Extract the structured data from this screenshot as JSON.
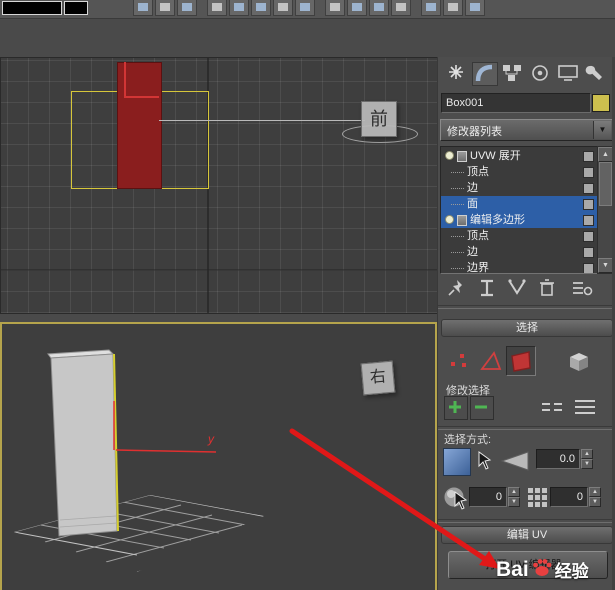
{
  "colors": {
    "highlight_blue": "#2d5fa7",
    "arrow_red": "#e01818",
    "swatch_yellow": "#cdbf4e",
    "box_red": "#8a1e1e",
    "active_viewport_border": "#b5a44c"
  },
  "toolbar": {
    "icons": [
      "named-selection-set",
      "mirror-icon",
      "align-icon",
      "layer-manager-icon",
      "graph-editors-icon",
      "material-editor-icon",
      "render-setup-icon",
      "render-frame-icon",
      "snap-toggle-icon"
    ]
  },
  "viewports": {
    "front": {
      "gizmo_label": "前"
    },
    "right": {
      "gizmo_label": "右",
      "axis_y_label": "y"
    }
  },
  "command_panel": {
    "tabs": [
      {
        "name": "create",
        "icon": "create-icon"
      },
      {
        "name": "modify",
        "icon": "modify-icon",
        "active": true
      },
      {
        "name": "hierarchy",
        "icon": "hierarchy-icon"
      },
      {
        "name": "motion",
        "icon": "motion-icon"
      },
      {
        "name": "display",
        "icon": "display-icon"
      },
      {
        "name": "utilities",
        "icon": "utilities-icon"
      }
    ],
    "object_name": "Box001",
    "modifier_dropdown": {
      "label": "修改器列表"
    },
    "stack": {
      "items": [
        {
          "label": "UVW 展开",
          "kind": "modifier",
          "selected": false
        },
        {
          "label": "顶点",
          "kind": "subobject",
          "selected": false
        },
        {
          "label": "边",
          "kind": "subobject",
          "selected": false
        },
        {
          "label": "面",
          "kind": "subobject",
          "selected": true
        },
        {
          "label": "编辑多边形",
          "kind": "modifier",
          "selected": true
        },
        {
          "label": "顶点",
          "kind": "subobject",
          "selected": false
        },
        {
          "label": "边",
          "kind": "subobject",
          "selected": false
        },
        {
          "label": "边界",
          "kind": "subobject",
          "selected": false
        }
      ]
    },
    "stack_toolbar_icons": [
      "pin-stack-icon",
      "show-end-result-icon",
      "make-unique-icon",
      "remove-modifier-icon",
      "configure-modifier-sets-icon"
    ],
    "selection_rollout": {
      "title": "选择",
      "subobject_icons": [
        "vertex-dots-icon",
        "edge-triangle-icon",
        "face-icon",
        "element-cube-icon"
      ],
      "modify_selection_label": "修改选择",
      "grow_shrink_icons": [
        "grow-selection-icon",
        "shrink-selection-icon",
        "loop-icon",
        "ring-icon"
      ],
      "select_by_label": "选择方式:",
      "spinner_angle": "0.0",
      "spinner_a": "0",
      "spinner_b": "0"
    },
    "edit_uv_rollout": {
      "title": "编辑 UV",
      "open_button": "打开 UV 编辑器..."
    }
  },
  "glyphs": {
    "dropdown_arrow": "▼",
    "spinner_up": "▲",
    "spinner_down": "▼",
    "scroll_up": "▲",
    "scroll_down": "▼"
  },
  "watermark": {
    "prefix": "Bai",
    "suffix": "经验"
  }
}
